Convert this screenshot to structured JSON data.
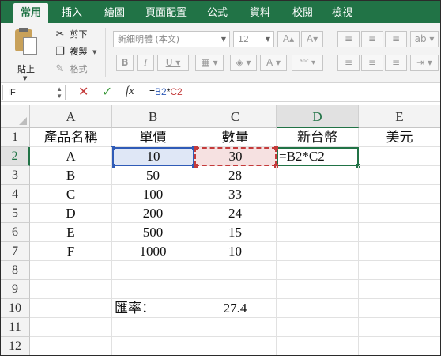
{
  "ribbon_tabs": [
    "常用",
    "插入",
    "繪圖",
    "頁面配置",
    "公式",
    "資料",
    "校閱",
    "檢視"
  ],
  "clipboard": {
    "paste_label": "貼上",
    "cut_label": "剪下",
    "copy_label": "複製",
    "format_label": "格式"
  },
  "font": {
    "name": "新細明體 (本文)",
    "size": "12"
  },
  "formula_bar": {
    "name_box": "IF",
    "fx": "fx",
    "formula_prefix": "=",
    "ref1": "B2",
    "operator": "*",
    "ref2": "C2"
  },
  "columns": [
    "A",
    "B",
    "C",
    "D",
    "E"
  ],
  "rows": [
    "1",
    "2",
    "3",
    "4",
    "5",
    "6",
    "7",
    "8",
    "9",
    "10",
    "11",
    "12"
  ],
  "cells": {
    "A1": "產品名稱",
    "B1": "單價",
    "C1": "數量",
    "D1": "新台幣",
    "E1": "美元",
    "A2": "A",
    "B2": "10",
    "C2": "30",
    "D2": "=B2*C2",
    "A3": "B",
    "B3": "50",
    "C3": "28",
    "A4": "C",
    "B4": "100",
    "C4": "33",
    "A5": "D",
    "B5": "200",
    "C5": "24",
    "A6": "E",
    "B6": "500",
    "C6": "15",
    "A7": "F",
    "B7": "1000",
    "C7": "10",
    "B10": "匯率：",
    "C10": "27.4"
  },
  "colors": {
    "accent": "#217346",
    "ref_blue": "#2f5bb7",
    "ref_red": "#c43b3b"
  }
}
